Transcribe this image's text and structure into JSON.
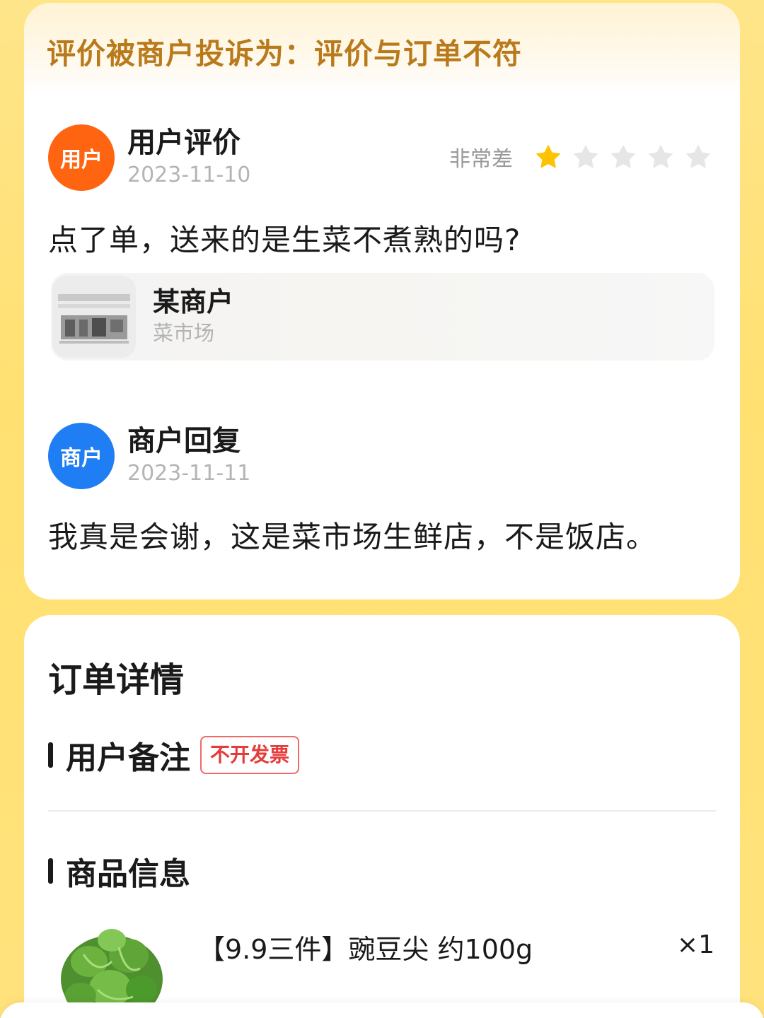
{
  "complaint": {
    "text": "评价被商户投诉为：评价与订单不符"
  },
  "user_review": {
    "avatar_label": "用户",
    "title": "用户评价",
    "date": "2023-11-10",
    "rating_label": "非常差",
    "rating": 1,
    "rating_max": 5,
    "text": "点了单，送来的是生菜不煮熟的吗?"
  },
  "shop": {
    "name": "某商户",
    "category": "菜市场"
  },
  "merchant_reply": {
    "avatar_label": "商户",
    "title": "商户回复",
    "date": "2023-11-11",
    "text": "我真是会谢，这是菜市场生鲜店，不是饭店。"
  },
  "order": {
    "title": "订单详情",
    "note_heading": "用户备注",
    "note_tag": "不开发票",
    "goods_heading": "商品信息",
    "product_name": "【9.9三件】豌豆尖 约100g",
    "product_qty": "×1"
  },
  "colors": {
    "star_active": "#ffc200",
    "star_inactive": "#e6e6e6",
    "user_avatar": "#ff6511",
    "merchant_avatar": "#1f7ef3",
    "complaint_text": "#b97a1c",
    "tag_red": "#e63b3b"
  }
}
